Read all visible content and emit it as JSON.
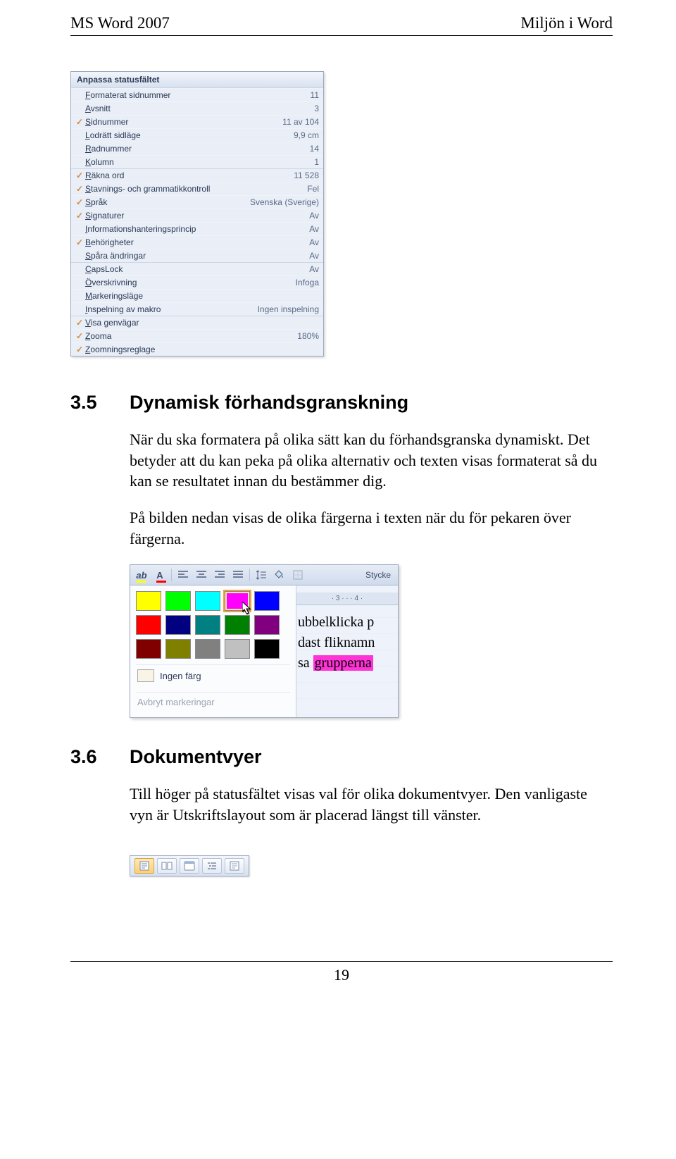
{
  "header": {
    "left": "MS Word 2007",
    "right": "Miljön i Word"
  },
  "statusbar_menu": {
    "title": "Anpassa statusfältet",
    "items": [
      {
        "checked": false,
        "label": "Formaterat sidnummer",
        "value": "11",
        "sep": false
      },
      {
        "checked": false,
        "label": "Avsnitt",
        "value": "3",
        "sep": false
      },
      {
        "checked": true,
        "label": "Sidnummer",
        "value": "11 av 104",
        "sep": false
      },
      {
        "checked": false,
        "label": "Lodrätt sidläge",
        "value": "9,9 cm",
        "sep": false
      },
      {
        "checked": false,
        "label": "Radnummer",
        "value": "14",
        "sep": false
      },
      {
        "checked": false,
        "label": "Kolumn",
        "value": "1",
        "sep": false
      },
      {
        "checked": true,
        "label": "Räkna ord",
        "value": "11 528",
        "sep": true
      },
      {
        "checked": true,
        "label": "Stavnings- och grammatikkontroll",
        "value": "Fel",
        "sep": false
      },
      {
        "checked": true,
        "label": "Språk",
        "value": "Svenska (Sverige)",
        "sep": false
      },
      {
        "checked": true,
        "label": "Signaturer",
        "value": "Av",
        "sep": false
      },
      {
        "checked": false,
        "label": "Informationshanteringsprincip",
        "value": "Av",
        "sep": false
      },
      {
        "checked": true,
        "label": "Behörigheter",
        "value": "Av",
        "sep": false
      },
      {
        "checked": false,
        "label": "Spåra ändringar",
        "value": "Av",
        "sep": false
      },
      {
        "checked": false,
        "label": "CapsLock",
        "value": "Av",
        "sep": true
      },
      {
        "checked": false,
        "label": "Överskrivning",
        "value": "Infoga",
        "sep": false
      },
      {
        "checked": false,
        "label": "Markeringsläge",
        "value": "",
        "sep": false
      },
      {
        "checked": false,
        "label": "Inspelning av makro",
        "value": "Ingen inspelning",
        "sep": false
      },
      {
        "checked": true,
        "label": "Visa genvägar",
        "value": "",
        "sep": true
      },
      {
        "checked": true,
        "label": "Zooma",
        "value": "180%",
        "sep": false
      },
      {
        "checked": true,
        "label": "Zoomningsreglage",
        "value": "",
        "sep": false
      }
    ]
  },
  "section35": {
    "num": "3.5",
    "title": "Dynamisk förhandsgranskning",
    "p1": "När du ska formatera på olika sätt kan du förhandsgranska dynamiskt. Det betyder att du kan peka på olika alternativ och texten visas formaterat så du kan se resultatet innan du bestämmer dig.",
    "p2": "På bilden nedan visas de olika färgerna i texten när du för pekaren över färgerna."
  },
  "color_picker": {
    "group_label": "Stycke",
    "ruler_text": "· 3 · · · 4 ·",
    "swatches": [
      [
        "#ffff00",
        "#00ff00",
        "#00ffff",
        "#ff00ff",
        "#0000ff"
      ],
      [
        "#ff0000",
        "#000080",
        "#008080",
        "#008000",
        "#800080"
      ],
      [
        "#800000",
        "#808000",
        "#808080",
        "#c0c0c0",
        "#000000"
      ]
    ],
    "selected_row": 0,
    "selected_col": 3,
    "no_color_label": "Ingen färg",
    "cancel_label": "Avbryt markeringar",
    "doc_line1": "ubbelklicka p",
    "doc_line2": "dast fliknamn",
    "doc_line3_pre": "sa ",
    "doc_line3_hl": "grupperna"
  },
  "section36": {
    "num": "3.6",
    "title": "Dokumentvyer",
    "p1": "Till höger på statusfältet visas val för olika dokumentvyer. Den vanligaste vyn är Utskriftslayout som är placerad längst till vänster."
  },
  "view_buttons": [
    {
      "name": "print-layout-view",
      "active": true
    },
    {
      "name": "fullscreen-reading-view",
      "active": false
    },
    {
      "name": "web-layout-view",
      "active": false
    },
    {
      "name": "outline-view",
      "active": false
    },
    {
      "name": "draft-view",
      "active": false
    }
  ],
  "footer": {
    "page": "19"
  }
}
